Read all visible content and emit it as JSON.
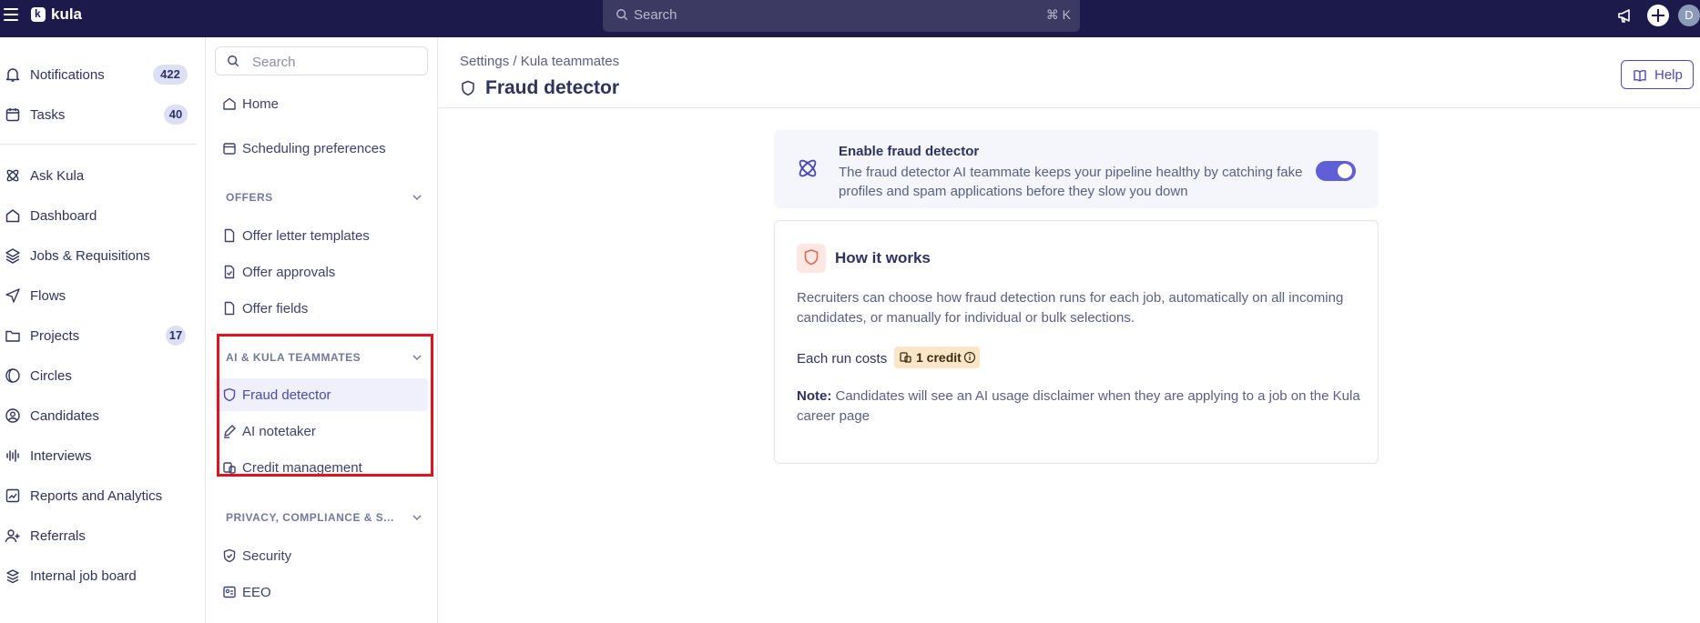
{
  "app": {
    "brand": "kula",
    "search_placeholder": "Search",
    "search_shortcut": "⌘ K",
    "avatar_initial": "D"
  },
  "left_nav": {
    "items": [
      {
        "label": "Notifications",
        "badge": "422",
        "icon": "bell-icon"
      },
      {
        "label": "Tasks",
        "badge": "40",
        "icon": "calendar-check-icon"
      },
      {
        "label": "Ask Kula",
        "icon": "atom-icon"
      },
      {
        "label": "Dashboard",
        "icon": "home-icon"
      },
      {
        "label": "Jobs & Requisitions",
        "icon": "layers-icon"
      },
      {
        "label": "Flows",
        "icon": "send-icon"
      },
      {
        "label": "Projects",
        "badge": "17",
        "icon": "folder-icon"
      },
      {
        "label": "Circles",
        "icon": "circles-icon"
      },
      {
        "label": "Candidates",
        "icon": "user-circle-icon"
      },
      {
        "label": "Interviews",
        "icon": "audio-wave-icon"
      },
      {
        "label": "Reports and Analytics",
        "icon": "chart-icon"
      },
      {
        "label": "Referrals",
        "icon": "user-plus-icon"
      },
      {
        "label": "Internal job board",
        "icon": "stack-icon"
      }
    ]
  },
  "settings_nav": {
    "search_placeholder": "Search",
    "home": "Home",
    "scheduling": "Scheduling preferences",
    "offers_section": "OFFERS",
    "offer_letter_templates": "Offer letter templates",
    "offer_approvals": "Offer approvals",
    "offer_fields": "Offer fields",
    "ai_section": "AI & KULA TEAMMATES",
    "fraud_detector": "Fraud detector",
    "ai_notetaker": "AI notetaker",
    "credit_management": "Credit management",
    "privacy_section": "PRIVACY, COMPLIANCE & S...",
    "security": "Security",
    "eeo": "EEO"
  },
  "main": {
    "breadcrumb": "Settings / Kula teammates",
    "title": "Fraud detector",
    "help_label": "Help",
    "enable_card": {
      "heading": "Enable fraud detector",
      "description": "The fraud detector AI teammate keeps your pipeline healthy by catching fake profiles and spam applications before they slow you down",
      "enabled": true
    },
    "how_card": {
      "heading": "How it works",
      "paragraph": "Recruiters can choose how fraud detection runs for each job, automatically on all incoming candidates, or manually for individual or bulk selections.",
      "cost_label": "Each run costs",
      "credit_label": "1 credit",
      "note_label": "Note:",
      "note_text": " Candidates will see an AI usage disclaimer when they are applying to a job on the Kula career page"
    }
  },
  "colors": {
    "topbar": "#1c1a4a",
    "accent": "#5f5fd8",
    "highlight": "#e0141e"
  }
}
